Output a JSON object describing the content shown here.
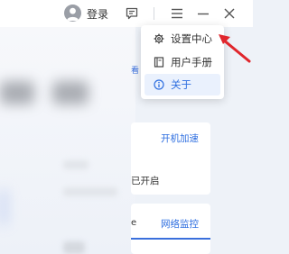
{
  "titlebar": {
    "login_label": "登录",
    "icons": [
      "user-avatar-icon",
      "feedback-icon",
      "menu-icon",
      "minimize-icon",
      "close-icon"
    ]
  },
  "dropdown": {
    "items": [
      {
        "label": "设置中心",
        "icon": "gear-icon"
      },
      {
        "label": "用户手册",
        "icon": "book-icon"
      },
      {
        "label": "关于",
        "icon": "info-icon",
        "highlighted": true
      }
    ]
  },
  "background": {
    "link_peek": "看",
    "card1": {
      "title": "开机加速",
      "status_text": "已开启"
    },
    "card2": {
      "title": "网络监控",
      "text_peek": "e"
    }
  },
  "colors": {
    "accent": "#2f6fe0",
    "arrow_red": "#e0262c",
    "highlight_bg": "#eaf1fd"
  }
}
